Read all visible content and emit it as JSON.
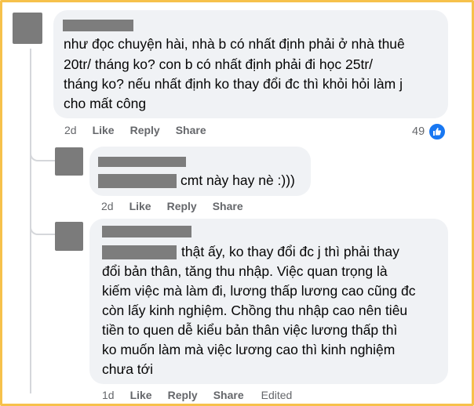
{
  "comments": [
    {
      "text_lines": [
        "như đọc chuyện hài, nhà b có nhất định phải ở nhà thuê",
        "20tr/ tháng ko? con b có nhất định phải đi học 25tr/",
        "tháng ko? nếu nhất định ko thay đổi đc thì khỏi hỏi làm j",
        "cho mất công"
      ],
      "time": "2d",
      "like": "Like",
      "reply": "Reply",
      "share": "Share",
      "reaction_count": "49"
    },
    {
      "text_after_name": "cmt này hay nè :)))",
      "time": "2d",
      "like": "Like",
      "reply": "Reply",
      "share": "Share"
    },
    {
      "first_line_after_name": "thật ấy, ko thay đổi đc j thì phải thay",
      "text_lines": [
        "đổi bản thân, tăng thu nhập. Việc quan trọng là",
        "kiếm việc mà làm đi, lương thấp lương cao cũng đc",
        "còn lấy kinh nghiệm. Chồng thu nhập cao nên tiêu",
        "tiền to quen dễ kiểu bản thân việc lương thấp thì",
        "ko muốn làm mà việc lương cao thì kinh nghiệm",
        "chưa tới"
      ],
      "time": "1d",
      "like": "Like",
      "reply": "Reply",
      "share": "Share",
      "edited": "Edited"
    }
  ],
  "colors": {
    "border": "#f6c14b",
    "bubble": "#f0f2f5",
    "redaction": "#7d7d7d",
    "like_blue": "#1877f2"
  },
  "icons": {
    "reaction": "like-thumb-icon"
  }
}
